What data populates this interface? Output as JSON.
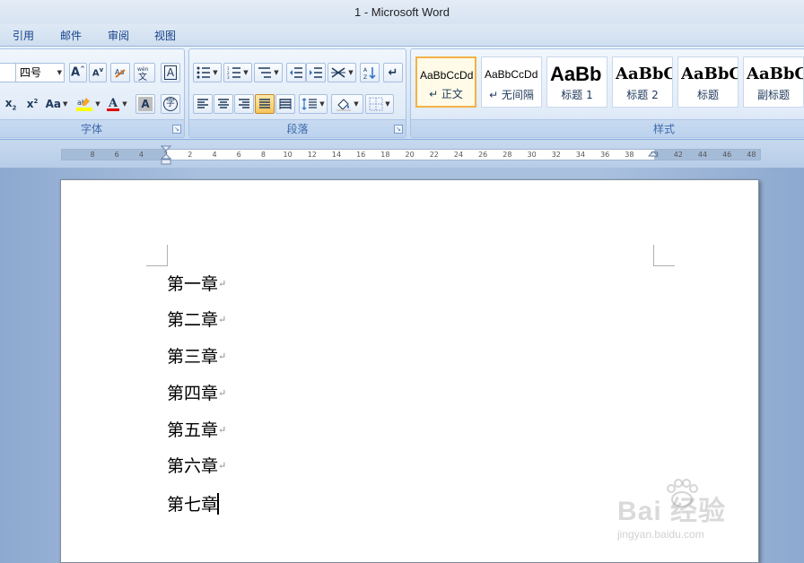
{
  "window": {
    "title": "1 - Microsoft Word"
  },
  "ribbon_tabs": [
    {
      "label": "引用"
    },
    {
      "label": "邮件"
    },
    {
      "label": "审阅"
    },
    {
      "label": "视图"
    }
  ],
  "font_group": {
    "label": "字体",
    "font_size": "四号",
    "icons": [
      "grow-font-icon",
      "shrink-font-icon",
      "clear-format-icon",
      "phonetic-guide-icon",
      "character-border-icon",
      "subscript-icon",
      "superscript-icon",
      "change-case-icon",
      "highlight-icon",
      "font-color-icon",
      "character-shading-icon",
      "enclose-characters-icon"
    ]
  },
  "paragraph_group": {
    "label": "段落",
    "icons": [
      "bullets-icon",
      "numbering-icon",
      "multilevel-list-icon",
      "decrease-indent-icon",
      "increase-indent-icon",
      "chinese-layout-icon",
      "sort-icon",
      "show-marks-icon",
      "align-left-icon",
      "center-icon",
      "align-right-icon",
      "justify-icon",
      "distributed-icon",
      "line-spacing-icon",
      "shading-icon",
      "borders-icon"
    ],
    "active": "justify-icon"
  },
  "styles_group": {
    "label": "样式",
    "styles": [
      {
        "sample": "AaBbCcDd",
        "name": "↵ 正文",
        "selected": true
      },
      {
        "sample": "AaBbCcDd",
        "name": "↵ 无间隔",
        "selected": false
      },
      {
        "sample": "AaBb",
        "name": "标题 1",
        "selected": false
      },
      {
        "sample": "AaBbC",
        "name": "标题 2",
        "selected": false
      },
      {
        "sample": "AaBbC",
        "name": "标题",
        "selected": false
      },
      {
        "sample": "AaBbC",
        "name": "副标题",
        "selected": false
      }
    ]
  },
  "ruler": {
    "ticks": [
      "8",
      "6",
      "4",
      "2",
      "2",
      "4",
      "6",
      "8",
      "10",
      "12",
      "14",
      "16",
      "18",
      "20",
      "22",
      "24",
      "26",
      "28",
      "30",
      "32",
      "34",
      "36",
      "38",
      "40",
      "42",
      "44",
      "46",
      "48"
    ]
  },
  "document": {
    "paragraphs": [
      "第一章",
      "第二章",
      "第三章",
      "第四章",
      "第五章",
      "第六章",
      "第七章"
    ],
    "paragraph_mark": "↵"
  },
  "watermark": {
    "title": "Bai 经验",
    "url": "jingyan.baidu.com"
  }
}
